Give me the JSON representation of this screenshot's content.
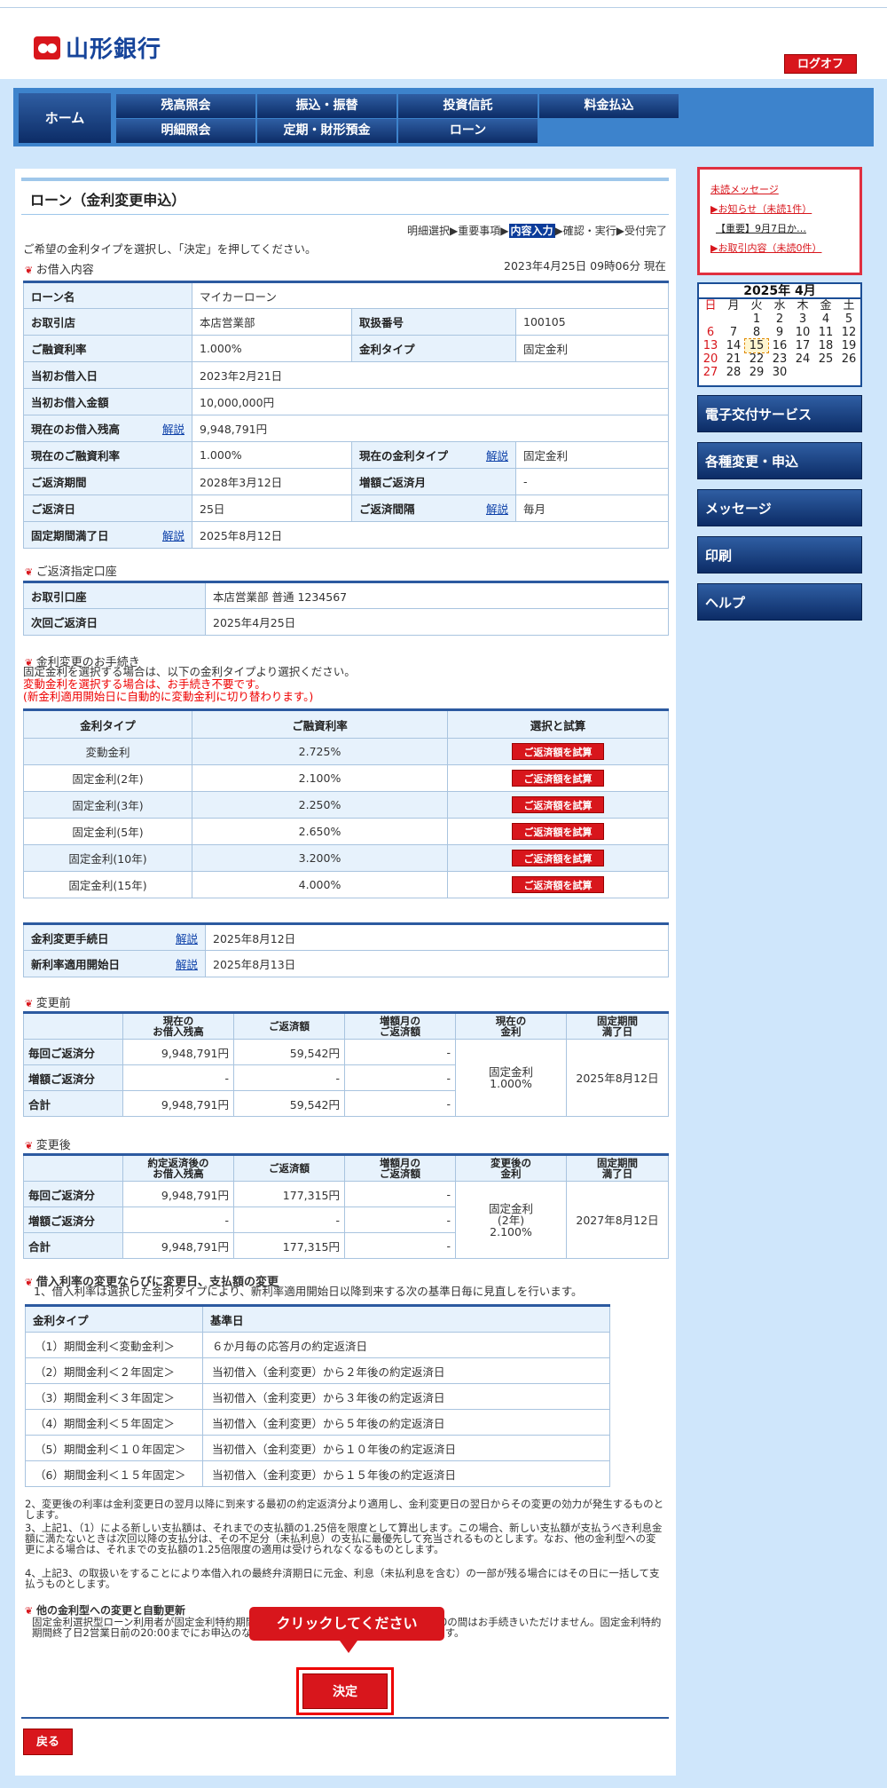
{
  "brand": {
    "name": "山形銀行"
  },
  "header": {
    "logoff": "ログオフ"
  },
  "nav": {
    "home": "ホーム",
    "items": [
      "残高照会",
      "振込・振替",
      "投資信託",
      "料金払込",
      "明細照会",
      "定期・財形預金",
      "ローン"
    ]
  },
  "page": {
    "title": "ローン（金利変更申込）",
    "steps": [
      "明細選択▶重要事項▶",
      "内容入力",
      "▶確認・実行▶受付完了"
    ],
    "instruction": "ご希望の金利タイプを選択し、「決定」を押してください。",
    "section_loan": "お借入内容",
    "timestamp": "2023年4月25日 09時06分 現在",
    "explain": "解説"
  },
  "loan": {
    "name_label": "ローン名",
    "name": "マイカーローン",
    "branch_label": "お取引店",
    "branch": "本店営業部",
    "trade_no_label": "取扱番号",
    "trade_no": "100105",
    "rate_label": "ご融資利率",
    "rate": "1.000%",
    "rate_type_label": "金利タイプ",
    "rate_type": "固定金利",
    "initial_date_label": "当初お借入日",
    "initial_date": "2023年2月21日",
    "initial_amount_label": "当初お借入金額",
    "initial_amount": "10,000,000円",
    "balance_label": "現在のお借入残高",
    "balance": "9,948,791円",
    "cur_rate_label": "現在のご融資利率",
    "cur_rate": "1.000%",
    "cur_type_label": "現在の金利タイプ",
    "cur_type": "固定金利",
    "period_label": "ご返済期間",
    "period": "2028年3月12日",
    "bonus_month_label": "増額ご返済月",
    "bonus_month": "-",
    "pay_day_label": "ご返済日",
    "pay_day": "25日",
    "interval_label": "ご返済間隔",
    "interval": "毎月",
    "fixed_end_label": "固定期間満了日",
    "fixed_end": "2025年8月12日"
  },
  "account": {
    "section": "ご返済指定口座",
    "acct_label": "お取引口座",
    "acct": "本店営業部 普通 1234567",
    "next_label": "次回ご返済日",
    "next": "2025年4月25日"
  },
  "procedure": {
    "section": "金利変更のお手続き",
    "line1": "固定金利を選択する場合は、以下の金利タイプより選択ください。",
    "line2": "変動金利を選択する場合は、お手続き不要です。",
    "line3": "(新金利適用開始日に自動的に変動金利に切り替わります。)"
  },
  "rates": {
    "headers": [
      "金利タイプ",
      "ご融資利率",
      "選択と試算"
    ],
    "button": "ご返済額を試算",
    "rows": [
      [
        "変動金利",
        "2.725%"
      ],
      [
        "固定金利(2年)",
        "2.100%"
      ],
      [
        "固定金利(3年)",
        "2.250%"
      ],
      [
        "固定金利(5年)",
        "2.650%"
      ],
      [
        "固定金利(10年)",
        "3.200%"
      ],
      [
        "固定金利(15年)",
        "4.000%"
      ]
    ]
  },
  "dates": {
    "proc_label": "金利変更手続日",
    "proc": "2025年8月12日",
    "start_label": "新利率適用開始日",
    "start": "2025年8月13日"
  },
  "before": {
    "section": "変更前",
    "headers": [
      "現在の\nお借入残高",
      "ご返済額",
      "増額月の\nご返済額",
      "現在の\n金利",
      "固定期間\n満了日"
    ],
    "rows": [
      [
        "毎回ご返済分",
        "9,948,791円",
        "59,542円",
        "-"
      ],
      [
        "増額ご返済分",
        "-",
        "-",
        "-"
      ],
      [
        "合計",
        "9,948,791円",
        "59,542円",
        "-"
      ]
    ],
    "rate": "固定金利\n1.000%",
    "end": "2025年8月12日"
  },
  "after": {
    "section": "変更後",
    "headers": [
      "約定返済後の\nお借入残高",
      "ご返済額",
      "増額月の\nご返済額",
      "変更後の\n金利",
      "固定期間\n満了日"
    ],
    "rows": [
      [
        "毎回ご返済分",
        "9,948,791円",
        "177,315円",
        "-"
      ],
      [
        "増額ご返済分",
        "-",
        "-",
        "-"
      ],
      [
        "合計",
        "9,948,791円",
        "177,315円",
        "-"
      ]
    ],
    "rate": "固定金利\n(2年)\n2.100%",
    "end": "2027年8月12日"
  },
  "rules": {
    "section": "借入利率の変更ならびに変更日、支払額の変更",
    "intro": "1、借入利率は選択した金利タイプにより、新利率適用開始日以降到来する次の基準日毎に見直しを行います。",
    "headers": [
      "金利タイプ",
      "基準日"
    ],
    "rows": [
      [
        "（1）期間金利＜変動金利＞",
        "６か月毎の応答月の約定返済日"
      ],
      [
        "（2）期間金利＜２年固定＞",
        "当初借入（金利変更）から２年後の約定返済日"
      ],
      [
        "（3）期間金利＜３年固定＞",
        "当初借入（金利変更）から３年後の約定返済日"
      ],
      [
        "（4）期間金利＜５年固定＞",
        "当初借入（金利変更）から５年後の約定返済日"
      ],
      [
        "（5）期間金利＜１０年固定＞",
        "当初借入（金利変更）から１０年後の約定返済日"
      ],
      [
        "（6）期間金利＜１５年固定＞",
        "当初借入（金利変更）から１５年後の約定返済日"
      ]
    ],
    "n2": "2、変更後の利率は金利変更日の翌月以降に到来する最初の約定返済分より適用し、金利変更日の翌日からその変更の効力が発生するものとします。",
    "n3": "3、上記1、（1）による新しい支払額は、それまでの支払額の1.25倍を限度として算出します。この場合、新しい支払額が支払うべき利息金額に満たないときは次回以降の支払分は、その不足分（未払利息）の支払に最優先して充当されるものとします。なお、他の金利型への変更による場合は、それまでの支払額の1.25倍限度の適用は受けられなくなるものとします。",
    "n4": "4、上記3、の取扱いをすることにより本借入れの最終弁済期日に元金、利息（未払利息を含む）の一部が残る場合にはその日に一括して支払うものとします。",
    "auto_section": "他の金利型への変更と自動更新",
    "auto": "固定金利選択型ローン利用者が固定金利特約期間終了日2営業日前の20:00から当日の7:00の間はお手続きいただけません。固定金利特約期間終了日2営業日前の20:00までにお申込のなかった場合は、自動的に変動金利となります。"
  },
  "actions": {
    "tooltip": "クリックしてください",
    "decide": "決定",
    "back": "戻る"
  },
  "side": {
    "msg_title": "未読メッセージ",
    "notice": "▶お知らせ（未読1件）",
    "important": "【重要】9月7日か…",
    "trade": "▶お取引内容（未読0件）",
    "cal_title": "2025年 4月",
    "weekdays": [
      "日",
      "月",
      "火",
      "水",
      "木",
      "金",
      "土"
    ],
    "weeks": [
      [
        "",
        "",
        "1",
        "2",
        "3",
        "4",
        "5"
      ],
      [
        "6",
        "7",
        "8",
        "9",
        "10",
        "11",
        "12"
      ],
      [
        "13",
        "14",
        "15",
        "16",
        "17",
        "18",
        "19"
      ],
      [
        "20",
        "21",
        "22",
        "23",
        "24",
        "25",
        "26"
      ],
      [
        "27",
        "28",
        "29",
        "30",
        "",
        "",
        ""
      ]
    ],
    "buttons": [
      "電子交付サービス",
      "各種変更・申込",
      "メッセージ",
      "印刷",
      "ヘルプ"
    ]
  }
}
